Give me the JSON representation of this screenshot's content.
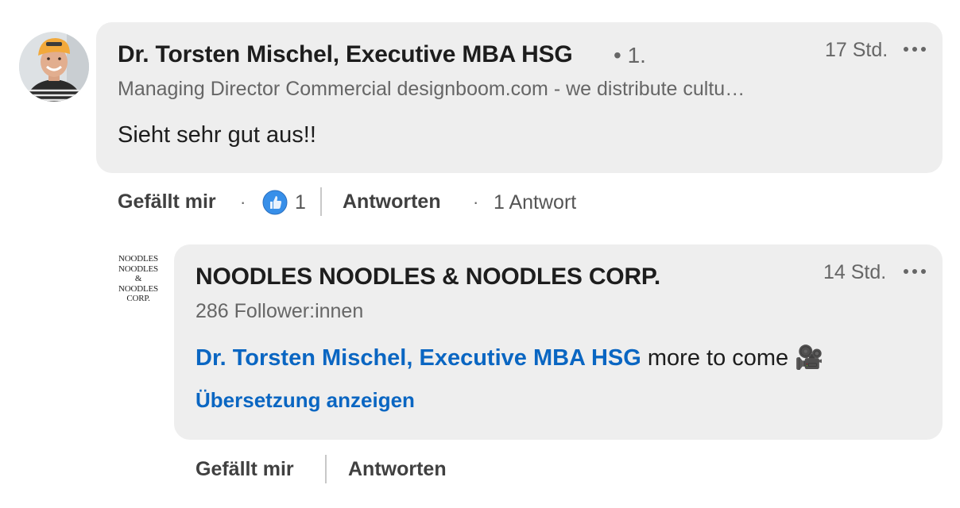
{
  "comment": {
    "author": "Dr. Torsten Mischel, Executive MBA HSG",
    "degree": "• 1.",
    "time": "17 Std.",
    "headline": "Managing Director Commercial designboom.com - we distribute cultu…",
    "text": "Sieht sehr gut aus!!",
    "actions": {
      "like_label": "Gefällt mir",
      "reaction_count": "1",
      "reply_label": "Antworten",
      "reply_count": "1 Antwort"
    }
  },
  "reply": {
    "logo_lines": [
      "NOODLES",
      "NOODLES",
      "&",
      "NOODLES",
      "CORP."
    ],
    "author": "NOODLES NOODLES & NOODLES CORP.",
    "time": "14 Std.",
    "followers": "286 Follower:innen",
    "mention": "Dr. Torsten Mischel, Executive MBA HSG",
    "text": " more to come 🎥",
    "translate_label": "Übersetzung anzeigen",
    "actions": {
      "like_label": "Gefällt mir",
      "reply_label": "Antworten"
    }
  },
  "colors": {
    "bubble": "#eeeeee",
    "link": "#0a66c2",
    "muted": "#666666",
    "like": "#378fe9"
  },
  "icons": [
    "avatar-photo",
    "more-icon",
    "like-reaction-icon",
    "movie-camera-emoji"
  ]
}
